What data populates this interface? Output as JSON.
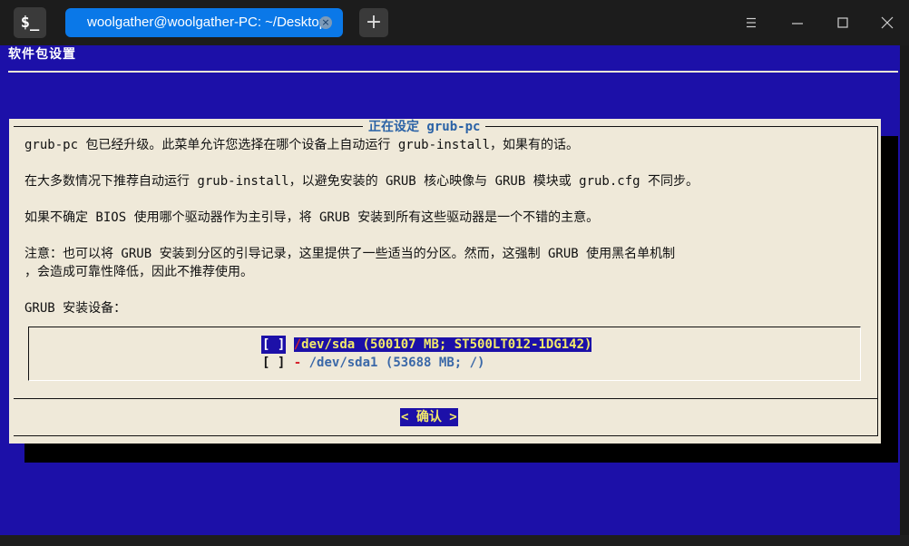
{
  "window": {
    "tab_title": "woolgather@woolgather-PC: ~/Desktop",
    "app_icon_glyph": "$_",
    "new_tab_glyph": "+",
    "close_glyph": "×"
  },
  "backtitle": "软件包设置",
  "dialog": {
    "title": "正在设定 grub-pc",
    "lines": [
      "grub-pc 包已经升级。此菜单允许您选择在哪个设备上自动运行 grub-install，如果有的话。",
      "在大多数情况下推荐自动运行 grub-install，以避免安装的 GRUB 核心映像与 GRUB 模块或 grub.cfg 不同步。",
      "如果不确定 BIOS 使用哪个驱动器作为主引导，将 GRUB 安装到所有这些驱动器是一个不错的主意。",
      "注意：也可以将 GRUB 安装到分区的引导记录，这里提供了一些适当的分区。然而，这强制 GRUB 使用黑名单机制",
      "，会造成可靠性降低，因此不推荐使用。",
      "GRUB 安装设备："
    ],
    "devices": [
      {
        "check": "[ ]",
        "dash": "/",
        "label": "dev/sda (500107 MB; ST500LT012-1DG142)",
        "selected": true
      },
      {
        "check": "[ ]",
        "dash": "-",
        "label": " /dev/sda1 (53688 MB; /)",
        "selected": false
      }
    ],
    "ok_button": "< 确认 >"
  },
  "colors": {
    "terminal_bg": "#1c10a8",
    "dialog_bg": "#efe9d9",
    "title_color": "#2a62a6",
    "highlight_text": "#f3ea6a",
    "tab_bg": "#0a78e8"
  }
}
